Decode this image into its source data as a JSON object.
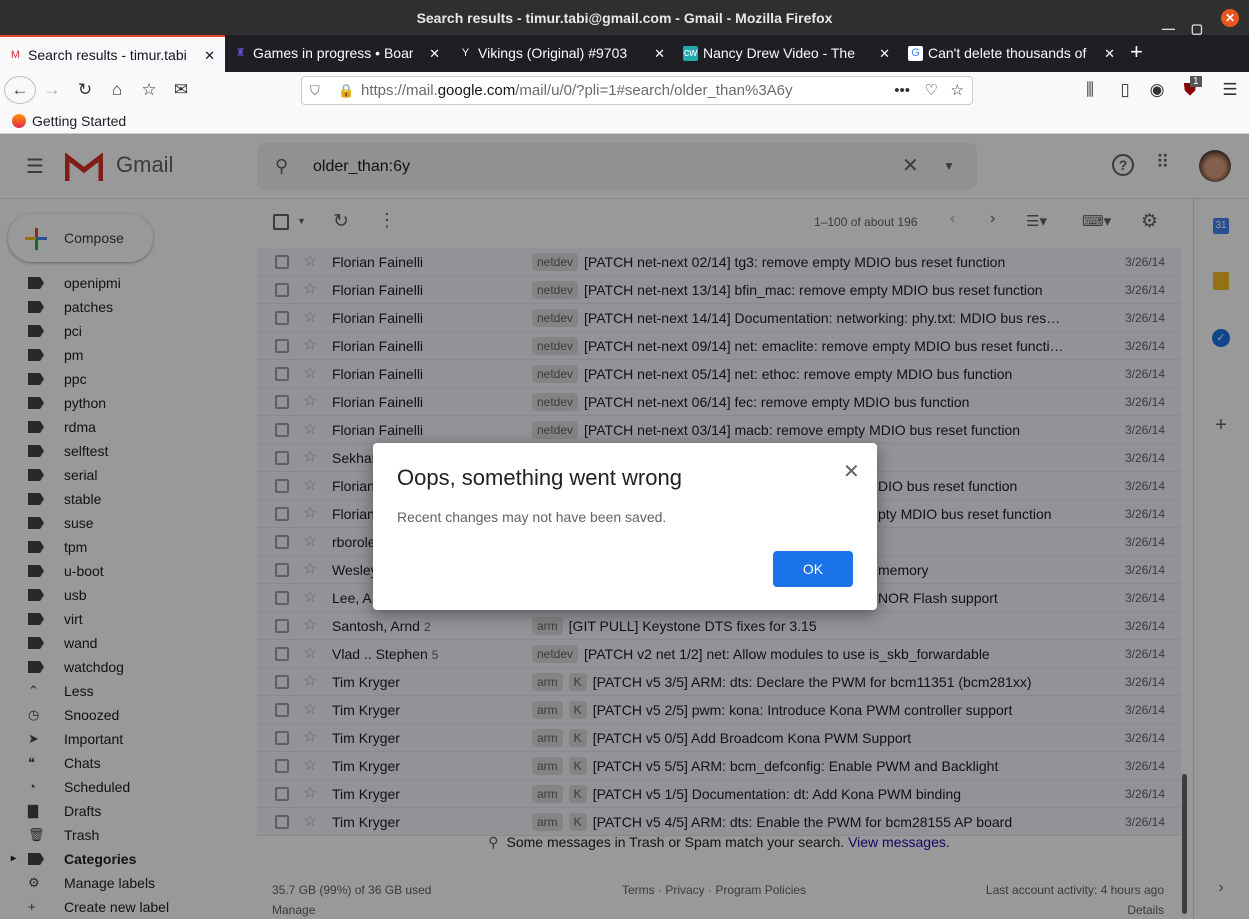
{
  "window": {
    "title": "Search results - timur.tabi@gmail.com - Gmail - Mozilla Firefox"
  },
  "tabs": [
    {
      "label": "Search results - timur.tabi@gmail.com",
      "icon": "gmail-icon",
      "active": true
    },
    {
      "label": "Games in progress • Board",
      "icon": "boardgame-icon"
    },
    {
      "label": "Vikings (Original) #9703",
      "icon": "vikings-icon"
    },
    {
      "label": "Nancy Drew Video - The",
      "icon": "cw-icon"
    },
    {
      "label": "Can't delete thousands of",
      "icon": "google-icon"
    }
  ],
  "url": {
    "prefix": "https://mail.",
    "domain": "google.com",
    "path": "/mail/u/0/?pli=1#search/older_than%3A6y"
  },
  "bookmarks": [
    {
      "label": "Getting Started"
    }
  ],
  "extension_badge": "1",
  "gmail": {
    "logo": "Gmail",
    "search_value": "older_than:6y",
    "compose": "Compose",
    "pagination": "1–100 of about 196",
    "sidebar": [
      {
        "label": "openipmi",
        "icon": "label"
      },
      {
        "label": "patches",
        "icon": "label"
      },
      {
        "label": "pci",
        "icon": "label"
      },
      {
        "label": "pm",
        "icon": "label"
      },
      {
        "label": "ppc",
        "icon": "label"
      },
      {
        "label": "python",
        "icon": "label"
      },
      {
        "label": "rdma",
        "icon": "label"
      },
      {
        "label": "selftest",
        "icon": "label"
      },
      {
        "label": "serial",
        "icon": "label"
      },
      {
        "label": "stable",
        "icon": "label"
      },
      {
        "label": "suse",
        "icon": "label"
      },
      {
        "label": "tpm",
        "icon": "label"
      },
      {
        "label": "u-boot",
        "icon": "label"
      },
      {
        "label": "usb",
        "icon": "label"
      },
      {
        "label": "virt",
        "icon": "label"
      },
      {
        "label": "wand",
        "icon": "label"
      },
      {
        "label": "watchdog",
        "icon": "label"
      },
      {
        "label": "Less",
        "icon": "chevron-up"
      },
      {
        "label": "Snoozed",
        "icon": "clock"
      },
      {
        "label": "Important",
        "icon": "important"
      },
      {
        "label": "Chats",
        "icon": "chat"
      },
      {
        "label": "Scheduled",
        "icon": "scheduled"
      },
      {
        "label": "Drafts",
        "icon": "draft"
      },
      {
        "label": "Trash",
        "icon": "trash"
      },
      {
        "label": "Categories",
        "icon": "label",
        "bold": true
      },
      {
        "label": "Manage labels",
        "icon": "gear"
      },
      {
        "label": "Create new label",
        "icon": "plus"
      }
    ],
    "emails": [
      {
        "sender": "Florian Fainelli",
        "labels": [
          "netdev"
        ],
        "subject": "[PATCH net-next 02/14] tg3: remove empty MDIO bus reset function",
        "date": "3/26/14"
      },
      {
        "sender": "Florian Fainelli",
        "labels": [
          "netdev"
        ],
        "subject": "[PATCH net-next 13/14] bfin_mac: remove empty MDIO bus reset function",
        "date": "3/26/14"
      },
      {
        "sender": "Florian Fainelli",
        "labels": [
          "netdev"
        ],
        "subject": "[PATCH net-next 14/14] Documentation: networking: phy.txt: MDIO bus res…",
        "date": "3/26/14"
      },
      {
        "sender": "Florian Fainelli",
        "labels": [
          "netdev"
        ],
        "subject": "[PATCH net-next 09/14] net: emaclite: remove empty MDIO bus reset functi…",
        "date": "3/26/14"
      },
      {
        "sender": "Florian Fainelli",
        "labels": [
          "netdev"
        ],
        "subject": "[PATCH net-next 05/14] net: ethoc: remove empty MDIO bus function",
        "date": "3/26/14"
      },
      {
        "sender": "Florian Fainelli",
        "labels": [
          "netdev"
        ],
        "subject": "[PATCH net-next 06/14] fec: remove empty MDIO bus function",
        "date": "3/26/14"
      },
      {
        "sender": "Florian Fainelli",
        "labels": [
          "netdev"
        ],
        "subject": "[PATCH net-next 03/14] macb: remove empty MDIO bus reset function",
        "date": "3/26/14"
      },
      {
        "sender": "Sekhar",
        "labels": [],
        "subject": "",
        "date": "3/26/14",
        "partial": true
      },
      {
        "sender": "Florian",
        "labels": [],
        "subject": "DIO bus reset function",
        "date": "3/26/14",
        "partial": true
      },
      {
        "sender": "Florian",
        "labels": [],
        "subject": "pty MDIO bus reset function",
        "date": "3/26/14",
        "partial": true
      },
      {
        "sender": "rborole",
        "labels": [],
        "subject": "",
        "date": "3/26/14",
        "partial": true
      },
      {
        "sender": "Wesley",
        "labels": [],
        "subject": "memory",
        "date": "3/26/14",
        "partial": true
      },
      {
        "sender": "Lee, A",
        "labels": [],
        "subject": "NOR Flash support",
        "date": "3/26/14",
        "partial": true
      },
      {
        "sender": "Santosh, Arnd",
        "count": "2",
        "labels": [
          "arm"
        ],
        "subject": "[GIT PULL] Keystone DTS fixes for 3.15",
        "date": "3/26/14"
      },
      {
        "sender": "Vlad .. Stephen",
        "count": "5",
        "labels": [
          "netdev"
        ],
        "subject": "[PATCH v2 net 1/2] net: Allow modules to use is_skb_forwardable",
        "date": "3/26/14"
      },
      {
        "sender": "Tim Kryger",
        "labels": [
          "arm",
          "K"
        ],
        "subject": "[PATCH v5 3/5] ARM: dts: Declare the PWM for bcm11351 (bcm281xx)",
        "date": "3/26/14"
      },
      {
        "sender": "Tim Kryger",
        "labels": [
          "arm",
          "K"
        ],
        "subject": "[PATCH v5 2/5] pwm: kona: Introduce Kona PWM controller support",
        "date": "3/26/14"
      },
      {
        "sender": "Tim Kryger",
        "labels": [
          "arm",
          "K"
        ],
        "subject": "[PATCH v5 0/5] Add Broadcom Kona PWM Support",
        "date": "3/26/14"
      },
      {
        "sender": "Tim Kryger",
        "labels": [
          "arm",
          "K"
        ],
        "subject": "[PATCH v5 5/5] ARM: bcm_defconfig: Enable PWM and Backlight",
        "date": "3/26/14"
      },
      {
        "sender": "Tim Kryger",
        "labels": [
          "arm",
          "K"
        ],
        "subject": "[PATCH v5 1/5] Documentation: dt: Add Kona PWM binding",
        "date": "3/26/14"
      },
      {
        "sender": "Tim Kryger",
        "labels": [
          "arm",
          "K"
        ],
        "subject": "[PATCH v5 4/5] ARM: dts: Enable the PWM for bcm28155 AP board",
        "date": "3/26/14"
      }
    ],
    "notice": {
      "text": "Some messages in Trash or Spam match your search.",
      "link": "View messages."
    },
    "footer": {
      "storage": "35.7 GB (99%) of 36 GB used",
      "manage": "Manage",
      "terms": "Terms",
      "privacy": "Privacy",
      "policies": "Program Policies",
      "activity": "Last account activity: 4 hours ago",
      "details": "Details"
    }
  },
  "dialog": {
    "title": "Oops, something went wrong",
    "message": "Recent changes may not have been saved.",
    "ok": "OK"
  },
  "colors": {
    "accent": "#1a73e8",
    "link": "#1a0dab"
  }
}
